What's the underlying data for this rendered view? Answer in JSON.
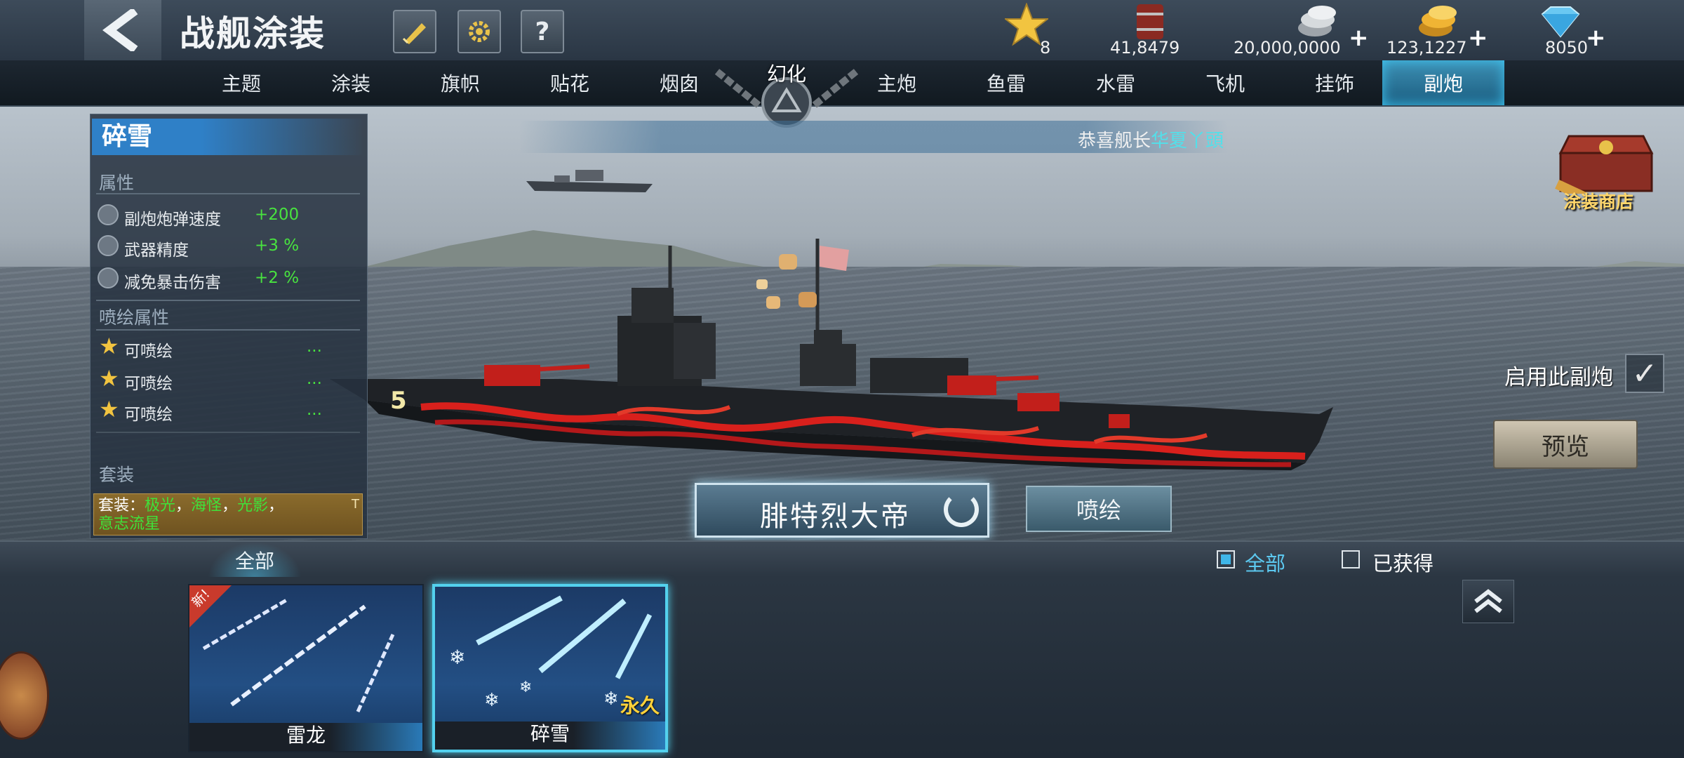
{
  "header": {
    "title": "战舰涂装",
    "buttons": [
      "paint-brush-icon",
      "gear-icon",
      "help-icon"
    ],
    "help_label": "?"
  },
  "resources": [
    {
      "icon": "star-icon",
      "value": "8"
    },
    {
      "icon": "oil-barrel-icon",
      "value": "41,8479"
    },
    {
      "icon": "silver-coin-icon",
      "value": "20,000,0000",
      "plus": "+"
    },
    {
      "icon": "gold-coin-icon",
      "value": "123,1227",
      "plus": "+"
    },
    {
      "icon": "diamond-icon",
      "value": "8050",
      "plus": "+"
    }
  ],
  "tabs": [
    "主题",
    "涂装",
    "旗帜",
    "贴花",
    "烟囱",
    "幻化",
    "主炮",
    "鱼雷",
    "水雷",
    "飞机",
    "挂饰",
    "副炮"
  ],
  "active_tab": "副炮",
  "left_panel": {
    "skin_name": "碎雪",
    "attributes_title": "属性",
    "attributes": [
      {
        "name": "副炮炮弹速度",
        "value": "+200"
      },
      {
        "name": "武器精度",
        "value": "+3 %"
      },
      {
        "name": "减免暴击伤害",
        "value": "+2 %"
      }
    ],
    "paint_attributes_title": "喷绘属性",
    "paint_attributes": [
      {
        "name": "可喷绘",
        "value": "..."
      },
      {
        "name": "可喷绘",
        "value": "..."
      },
      {
        "name": "可喷绘",
        "value": "..."
      }
    ],
    "set_title": "套装",
    "set_prefix": "套装：",
    "set_items": [
      "极光",
      "海怪",
      "光影",
      "意志流星"
    ],
    "set_corner": "T"
  },
  "broadcast": {
    "prefix": "恭喜舰长",
    "name": "华夏丫頭"
  },
  "shop_label": "涂装商店",
  "enable_label": "启用此副炮",
  "enable_checked": true,
  "preview_label": "预览",
  "ship_name": "腓特烈大帝",
  "paint_label": "喷绘",
  "ship_hull_number": "5",
  "filter": {
    "tab_label": "全部",
    "options": [
      {
        "label": "全部",
        "checked": true
      },
      {
        "label": "已获得",
        "checked": false
      }
    ]
  },
  "cards": [
    {
      "label": "雷龙",
      "tag": "新!",
      "badge": "",
      "selected": false
    },
    {
      "label": "碎雪",
      "tag": "",
      "badge": "永久",
      "selected": true
    }
  ],
  "colors": {
    "accent": "#3fc6f2",
    "positive": "#48e23f",
    "gold": "#ffd23a",
    "ship_stripe": "#d8201c"
  }
}
